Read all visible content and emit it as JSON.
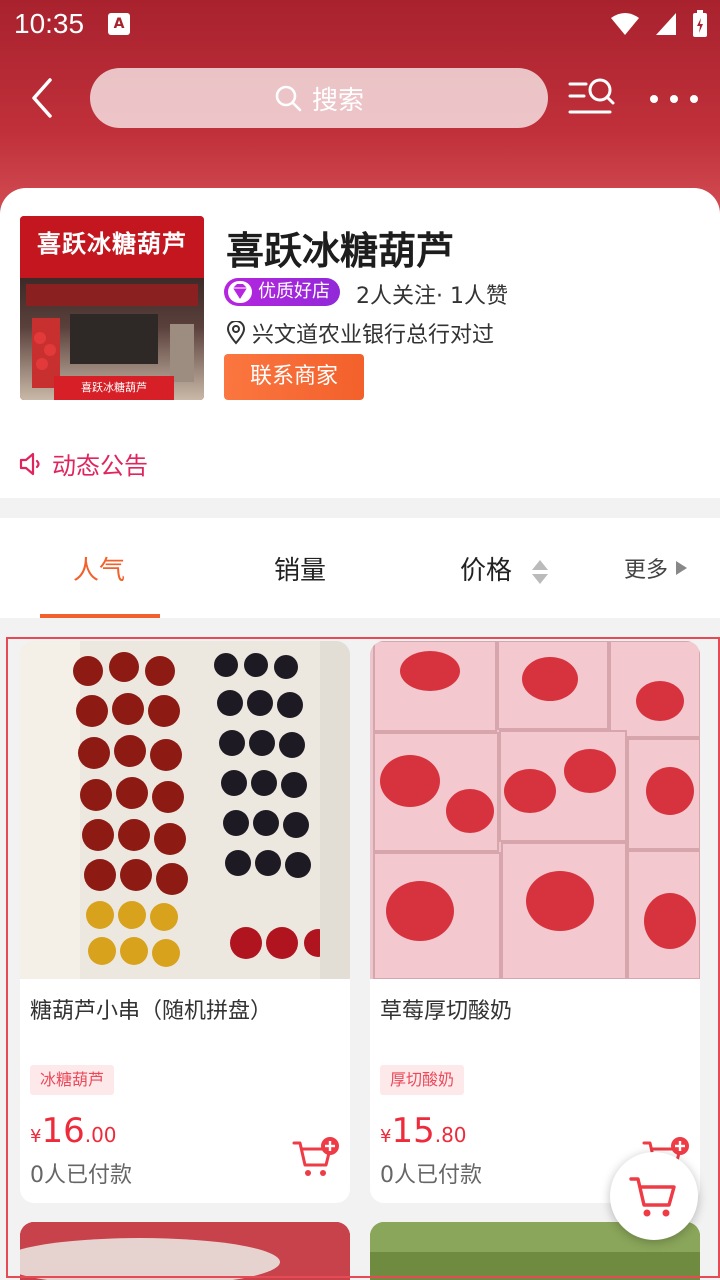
{
  "status_bar": {
    "time": "10:35",
    "notification_icon": "A"
  },
  "nav": {
    "search_placeholder": "搜索"
  },
  "shop": {
    "logo_sign_text": "喜跃冰糖葫芦",
    "logo_counter_text": "喜跃冰糖葫芦",
    "name": "喜跃冰糖葫芦",
    "badge": "优质好店",
    "follow_stats": "2人关注· 1人赞",
    "address": "兴文道农业银行总行对过",
    "contact_button": "联系商家",
    "announcement": "动态公告"
  },
  "sort_tabs": [
    {
      "label": "人气",
      "active": true
    },
    {
      "label": "销量",
      "active": false
    },
    {
      "label": "价格",
      "active": false
    },
    {
      "label": "更多",
      "active": false
    }
  ],
  "products": [
    {
      "title": "糖葫芦小串（随机拼盘）",
      "tag": "冰糖葫芦",
      "currency": "¥",
      "price_int": "16",
      "price_dec": ".00",
      "sold": "0人已付款"
    },
    {
      "title": "草莓厚切酸奶",
      "tag": "厚切酸奶",
      "currency": "¥",
      "price_int": "15",
      "price_dec": ".80",
      "sold": "0人已付款"
    }
  ],
  "colors": {
    "header_red": "#a8222e",
    "accent_orange": "#f2612b",
    "price_red": "#ee2b3b",
    "badge_purple": "#b625e0",
    "announce_pink": "#e0245e"
  }
}
